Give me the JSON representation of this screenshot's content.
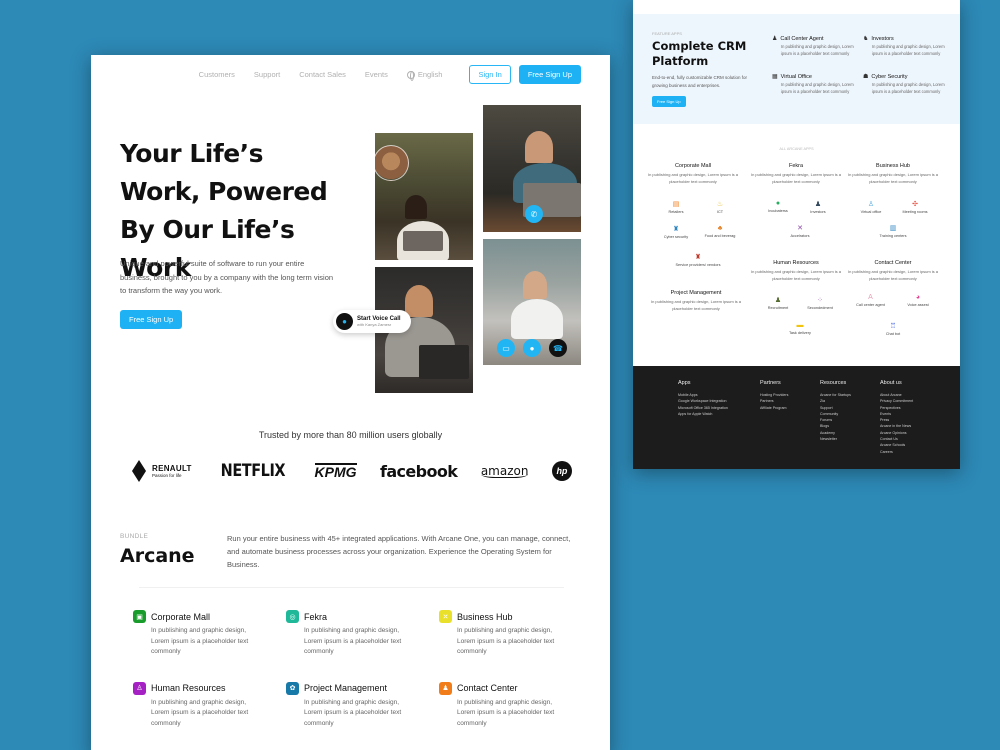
{
  "left_page": {
    "nav": {
      "links": [
        "Customers",
        "Support",
        "Contact Sales",
        "Events"
      ],
      "language": "English",
      "signin_label": "Sign In",
      "signup_label": "Free Sign Up"
    },
    "hero": {
      "title": "Your Life’s Work, Powered By Our Life’s Work",
      "description": "Unique and powerful suite of software to run your entire business, brought to you by a company with the long term vision to transform the way you work.",
      "cta_label": "Free Sign Up",
      "voice_call": {
        "title": "Start Voice Call",
        "subtitle": "with Kanya Zamesr"
      }
    },
    "trusted_text": "Trusted by more than 80 million users globally",
    "logos": {
      "renault": {
        "name": "RENAULT",
        "tagline": "Passion for life"
      },
      "netflix": "NETFLIX",
      "kpmg": "KPMG",
      "facebook": "facebook",
      "amazon": "amazon",
      "hp": "hp"
    },
    "bundle": {
      "label": "BUNDLE",
      "title": "Arcane",
      "description": "Run your entire business with 45+ integrated applications. With Arcane One, you can manage, connect, and automate business processes across your organization. Experience the Operating System for Business."
    },
    "apps": [
      {
        "name": "Corporate Mall",
        "desc": "In publishing and graphic design, Lorem ipsum is a placeholder text commonly",
        "color": "#1a9c2c"
      },
      {
        "name": "Fekra",
        "desc": "In publishing and graphic design, Lorem ipsum is a placeholder text commonly",
        "color": "#1fb99a"
      },
      {
        "name": "Business Hub",
        "desc": "In publishing and graphic design, Lorem ipsum is a placeholder text commonly",
        "color": "#e8e02a"
      },
      {
        "name": "Human Resources",
        "desc": "In publishing and graphic design, Lorem ipsum is a placeholder text commonly",
        "color": "#a621c4"
      },
      {
        "name": "Project Management",
        "desc": "In publishing and graphic design, Lorem ipsum is a placeholder text commonly",
        "color": "#1779a8"
      },
      {
        "name": "Contact Center",
        "desc": "In publishing and graphic design, Lorem ipsum is a placeholder text commonly",
        "color": "#f07d1a"
      }
    ]
  },
  "right_page": {
    "feature_label": "FEATURE APPS",
    "crm_title": "Complete CRM Platform",
    "crm_desc": "End-to-end, fully customizable CRM solution for growing business and enterprises.",
    "crm_btn": "Free Sign Up",
    "features": [
      {
        "name": "Call Center Agent",
        "desc": "In publishing and graphic design, Lorem ipsum is a placeholder text commonly"
      },
      {
        "name": "Investors",
        "desc": "In publishing and graphic design, Lorem ipsum is a placeholder text commonly"
      },
      {
        "name": "Virtual Office",
        "desc": "In publishing and graphic design, Lorem ipsum is a placeholder text commonly"
      },
      {
        "name": "Cyber Security",
        "desc": "In publishing and graphic design, Lorem ipsum is a placeholder text commonly"
      }
    ],
    "all_apps_label": "ALL ARCANE APPS",
    "groups": [
      {
        "name": "Corporate Mall",
        "desc": "In publishing and graphic design, Lorem ipsum is a placeholder text commonly",
        "subs": [
          "Retailers",
          "ICT",
          "Cyber security",
          "Food and beverag",
          "Service providers/ vendors"
        ]
      },
      {
        "name": "Fekra",
        "desc": "In publishing and graphic design, Lorem ipsum is a placeholder text commonly",
        "subs": [
          "Incubaterss",
          "Investors",
          "Accelrators"
        ]
      },
      {
        "name": "Business Hub",
        "desc": "In publishing and graphic design, Lorem ipsum is a placeholder text commonly",
        "subs": [
          "Virtual office",
          "Meeting rooms",
          "Training centers"
        ]
      },
      {
        "name": "Human Resources",
        "desc": "In publishing and graphic design, Lorem ipsum is a placeholder text commonly",
        "subs": [
          "Recruitment",
          "Secondedment",
          "Task delivery"
        ]
      },
      {
        "name": "Contact Center",
        "desc": "In publishing and graphic design, Lorem ipsum is a placeholder text commonly",
        "subs": [
          "Call center agent",
          "Voice assest",
          "Chat bot"
        ]
      },
      {
        "name": "Project Management",
        "desc": "In publishing and graphic design, Lorem ipsum is a placeholder text commonly",
        "subs": []
      }
    ],
    "footer": {
      "columns": [
        {
          "title": "Apps",
          "links": [
            "Mobile Apps",
            "Google Workspace Integration",
            "Microsoft Office 365 Integration",
            "Apps for Apple Watch"
          ]
        },
        {
          "title": "Partners",
          "links": [
            "Hosting Providers",
            "Partners",
            "Affiliate Program"
          ]
        },
        {
          "title": "Resources",
          "links": [
            "Arcane for Startups",
            "Zia",
            "Support",
            "Community",
            "Forums",
            "Blogs",
            "Academy",
            "Newsletter"
          ]
        },
        {
          "title": "About us",
          "links": [
            "About Arcane",
            "Privacy Commitment",
            "Perspectives",
            "Events",
            "Press",
            "Arcane in the News",
            "Arcane Opinions",
            "Contact Us",
            "Arcane Schools",
            "Careers"
          ]
        }
      ]
    }
  }
}
